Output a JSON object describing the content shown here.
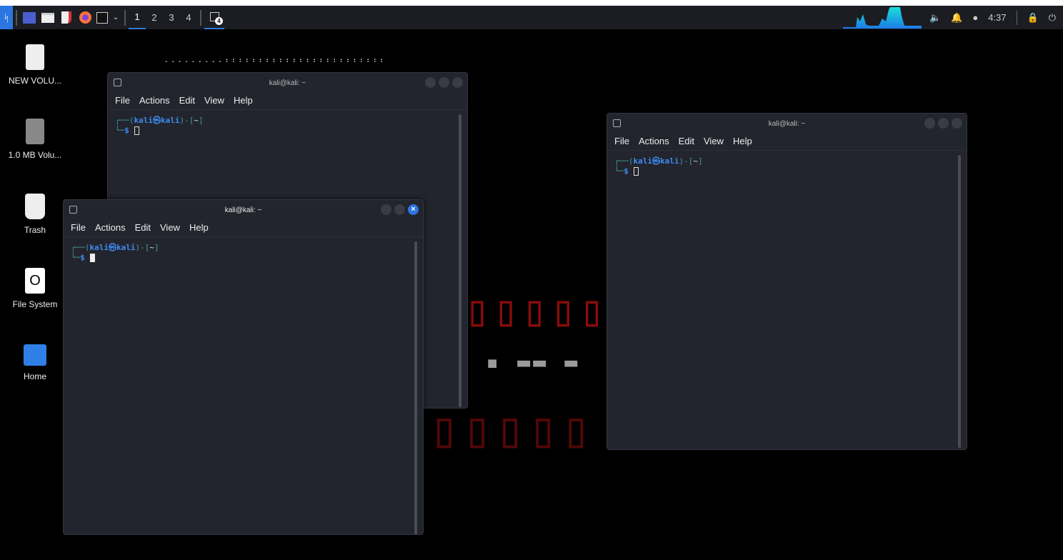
{
  "panel": {
    "workspaces": [
      "1",
      "2",
      "3",
      "4"
    ],
    "active_workspace": "1",
    "window_count_badge": "4",
    "clock": "4:37"
  },
  "desktop_icons": [
    {
      "label": "NEW VOLU..."
    },
    {
      "label": "1.0 MB Volu..."
    },
    {
      "label": "Trash"
    },
    {
      "label": "File System"
    },
    {
      "label": "Home"
    }
  ],
  "windows": [
    {
      "title": "kali@kali: ~",
      "menu": [
        "File",
        "Actions",
        "Edit",
        "View",
        "Help"
      ],
      "prompt_user": "kali㉿kali",
      "prompt_dir": "~",
      "prompt_symbol": "$"
    },
    {
      "title": "kali@kali: ~",
      "menu": [
        "File",
        "Actions",
        "Edit",
        "View",
        "Help"
      ],
      "prompt_user": "kali㉿kali",
      "prompt_dir": "~",
      "prompt_symbol": "$"
    },
    {
      "title": "kali@kali: ~",
      "menu": [
        "File",
        "Actions",
        "Edit",
        "View",
        "Help"
      ],
      "prompt_user": "kali㉿kali",
      "prompt_dir": "~",
      "prompt_symbol": "$"
    }
  ],
  "colors": {
    "accent": "#2b76e0",
    "prompt_green": "#3a9c93",
    "prompt_blue": "#3d8bf0"
  }
}
